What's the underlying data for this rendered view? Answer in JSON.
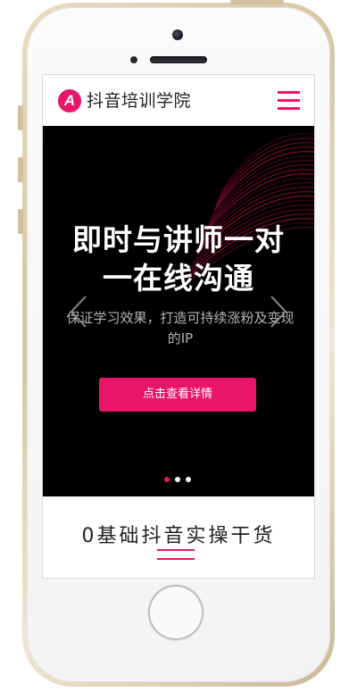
{
  "header": {
    "logo_letter": "A",
    "logo_text": "抖音培训学院",
    "menu_icon": "hamburger-menu-icon"
  },
  "banner": {
    "headline_line1": "即时与讲师一对",
    "headline_line2": "一在线沟通",
    "subline_line1": "保证学习效果，打造可持续涨粉及变现",
    "subline_line2": "的IP",
    "cta_label": "点击查看详情",
    "prev_icon": "chevron-left-icon",
    "next_icon": "chevron-right-icon",
    "slide_count": 3,
    "active_slide": 1
  },
  "section": {
    "title": "0基础抖音实操干货"
  },
  "colors": {
    "accent": "#ea1568",
    "banner_bg": "#000000",
    "text_dark": "#222222"
  }
}
